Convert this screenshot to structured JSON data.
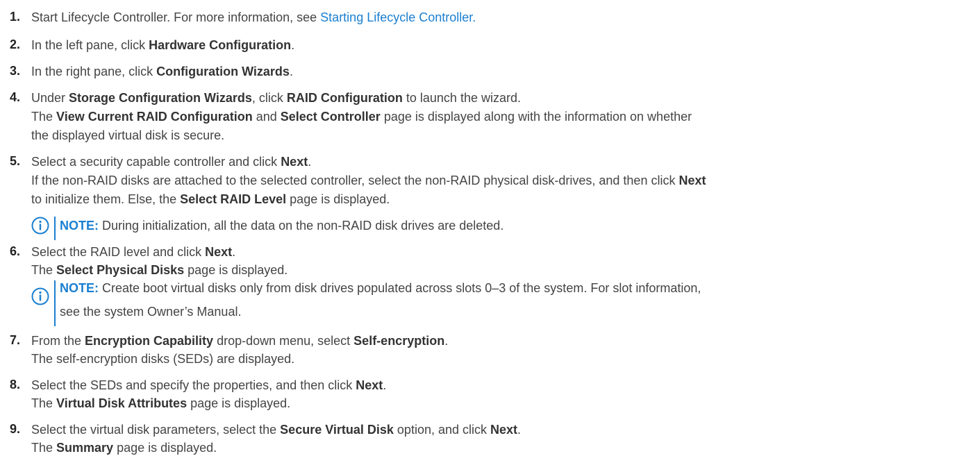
{
  "steps": [
    {
      "number": "1.",
      "line1": {
        "text": "Start Lifecycle Controller. For more information, see ",
        "link": "Starting Lifecycle Controller."
      }
    },
    {
      "number": "2.",
      "line1": {
        "pre": "In the left pane, click ",
        "bold": "Hardware Configuration",
        "post": "."
      }
    },
    {
      "number": "3.",
      "line1": {
        "pre": "In the right pane, click ",
        "bold": "Configuration Wizards",
        "post": "."
      }
    },
    {
      "number": "4.",
      "line1": {
        "pre": "Under ",
        "bold1": "Storage Configuration Wizards",
        "mid": ", click ",
        "bold2": "RAID Configuration",
        "post": " to launch the wizard."
      },
      "line2": {
        "pre": "The ",
        "bold1": "View Current RAID Configuration",
        "mid": " and ",
        "bold2": "Select Controller",
        "post": " page is displayed along with the information on whether"
      },
      "line3": "the displayed virtual disk is secure."
    },
    {
      "number": "5.",
      "line1": {
        "pre": "Select a security capable controller and click ",
        "bold": "Next",
        "post": "."
      },
      "line2": {
        "pre": "If the non-RAID disks are attached to the selected controller, select the non-RAID physical disk-drives, and then click ",
        "bold": "Next"
      },
      "line3": {
        "pre": "to initialize them. Else, the ",
        "bold": "Select RAID Level",
        "post": " page is displayed."
      },
      "note": {
        "label": "NOTE:",
        "text": " During initialization, all the data on the non-RAID disk drives are deleted."
      }
    },
    {
      "number": "6.",
      "line1": {
        "pre": "Select the RAID level and click ",
        "bold": "Next",
        "post": "."
      },
      "line2": {
        "pre": "The ",
        "bold": "Select Physical Disks",
        "post": " page is displayed."
      },
      "note": {
        "label": "NOTE:",
        "text": " Create boot virtual disks only from disk drives populated across slots 0–3 of the system. For slot information,",
        "text2": "see the system Owner’s Manual."
      }
    },
    {
      "number": "7.",
      "line1": {
        "pre": "From the ",
        "bold1": "Encryption Capability",
        "mid": " drop-down menu, select ",
        "bold2": "Self-encryption",
        "post": "."
      },
      "line2": "The self-encryption disks (SEDs) are displayed."
    },
    {
      "number": "8.",
      "line1": {
        "pre": "Select the SEDs and specify the properties, and then click ",
        "bold": "Next",
        "post": "."
      },
      "line2": {
        "pre": "The ",
        "bold": "Virtual Disk Attributes",
        "post": " page is displayed."
      }
    },
    {
      "number": "9.",
      "line1": {
        "pre": "Select the virtual disk parameters, select the ",
        "bold": "Secure Virtual Disk",
        "mid": " option, and click ",
        "bold2": "Next",
        "post": "."
      },
      "line2": {
        "pre": "The ",
        "bold": "Summary",
        "post": " page is displayed."
      }
    }
  ],
  "colors": {
    "link": "#1a7fd0",
    "text": "#444444",
    "number": "#222222"
  },
  "icons": {
    "note": "info-circle-icon"
  }
}
